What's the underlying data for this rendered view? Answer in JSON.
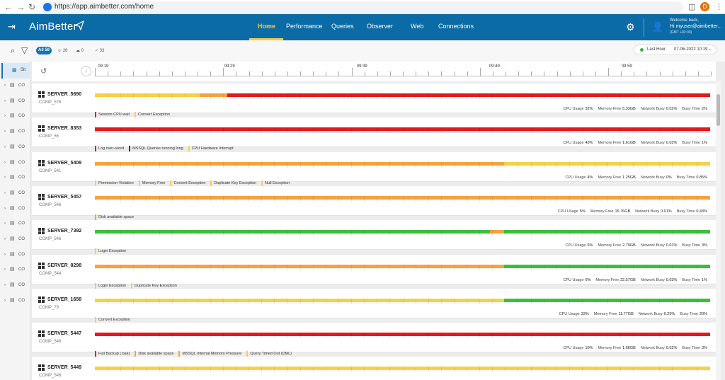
{
  "browser": {
    "url": "https://app.aimbetter.com/home",
    "profile_initial": "D"
  },
  "header": {
    "logo": "AimBetter",
    "tabs": [
      "Home",
      "Performance",
      "Queries",
      "Observer",
      "Web",
      "Connections"
    ],
    "active_tab": "Home",
    "welcome": "Welcome back,",
    "greeting": "Hi myuser@aimbetter...",
    "timezone": "(GMT +02:00)"
  },
  "filterbar": {
    "all_label": "All 59",
    "count_users": "26",
    "count_cloud": "0",
    "count_check": "33",
    "time_range": "Last Hour",
    "time_value": "07-06-2022 10:19"
  },
  "sidebar": {
    "header_label": "Sit",
    "items": [
      "CO",
      "CO",
      "CO",
      "CO",
      "CO",
      "CO",
      "CO",
      "CO",
      "CO",
      "CO",
      "CO",
      "CO",
      "CO",
      "CO",
      "CO"
    ]
  },
  "timeline": {
    "labels": [
      "09:19",
      "09:29",
      "09:39",
      "09:49",
      "09:59"
    ]
  },
  "colors": {
    "red": "#e11b1b",
    "yellow": "#f3d24a",
    "orange": "#f4a43c",
    "green": "#3dbe3d",
    "navy": "#1f3a5a",
    "blue": "#2a8ad5",
    "brand": "#0a6ba6"
  },
  "metric_labels": {
    "cpu": "CPU Usage",
    "mem": "Memory Free",
    "net": "Network Busy",
    "busy": "Busy Time"
  },
  "servers": [
    {
      "name": "SERVER_5690",
      "comp": "COMP_576",
      "segments": [
        {
          "from": 0,
          "to": 0.17,
          "color": "yellow"
        },
        {
          "from": 0.17,
          "to": 0.215,
          "color": "orange"
        },
        {
          "from": 0.215,
          "to": 1,
          "color": "red"
        }
      ],
      "alerts": [
        {
          "label": "Session CPU wait",
          "color": "red"
        },
        {
          "label": "Convert Exception",
          "color": "yellow"
        }
      ],
      "cpu": "32%",
      "mem": "5.33GB",
      "net": "0.02%",
      "busy": "2%"
    },
    {
      "name": "SERVER_8353",
      "comp": "COMP_66",
      "segments": [
        {
          "from": 0,
          "to": 1,
          "color": "red"
        }
      ],
      "blue_line": true,
      "alerts": [
        {
          "label": "Log over-sized",
          "color": "red"
        },
        {
          "label": "MSSQL Queries running long",
          "color": "navy"
        },
        {
          "label": "CPU Hardware Interrupt",
          "color": "yellow"
        }
      ],
      "cpu": "43%",
      "mem": "1.61GB",
      "net": "0.03%",
      "busy": "1%"
    },
    {
      "name": "SERVER_5409",
      "comp": "COMP_541",
      "segments": [
        {
          "from": 0,
          "to": 0.665,
          "color": "orange"
        },
        {
          "from": 0.665,
          "to": 1,
          "color": "yellow"
        }
      ],
      "alerts": [
        {
          "label": "Permission Violation",
          "color": "yellow"
        },
        {
          "label": "Memory Free",
          "color": "yellow"
        },
        {
          "label": "Convert Exception",
          "color": "yellow"
        },
        {
          "label": "Duplicate Key Exception",
          "color": "yellow"
        },
        {
          "label": "Null Exception",
          "color": "yellow"
        }
      ],
      "cpu": "4%",
      "mem": "1.25GB",
      "net": "0%",
      "busy": "0.85%"
    },
    {
      "name": "SERVER_5457",
      "comp": "COMP_546",
      "segments": [
        {
          "from": 0,
          "to": 1,
          "color": "orange"
        }
      ],
      "alerts": [
        {
          "label": "Disk available space",
          "color": "orange"
        }
      ],
      "cpu": "5%",
      "mem": "15.76GB",
      "net": "0.01%",
      "busy": "0.43%"
    },
    {
      "name": "SERVER_7392",
      "comp": "COMP_546",
      "segments": [
        {
          "from": 0,
          "to": 0.642,
          "color": "green"
        },
        {
          "from": 0.642,
          "to": 0.665,
          "color": "orange"
        },
        {
          "from": 0.665,
          "to": 1,
          "color": "green"
        }
      ],
      "alerts": [
        {
          "label": "Login Exception",
          "color": "yellow"
        }
      ],
      "cpu": "6%",
      "mem": "2.79GB",
      "net": "0.01%",
      "busy": "3%"
    },
    {
      "name": "SERVER_8298",
      "comp": "COMP_544",
      "segments": [
        {
          "from": 0,
          "to": 0.665,
          "color": "orange"
        },
        {
          "from": 0.665,
          "to": 1,
          "color": "green"
        }
      ],
      "alerts": [
        {
          "label": "Login Exception",
          "color": "yellow"
        },
        {
          "label": "Duplicate Key Exception",
          "color": "yellow"
        }
      ],
      "cpu": "6%",
      "mem": "22.57GB",
      "net": "0.03%",
      "busy": "1%"
    },
    {
      "name": "SERVER_1658",
      "comp": "COMP_79",
      "segments": [
        {
          "from": 0,
          "to": 0.665,
          "color": "yellow"
        },
        {
          "from": 0.665,
          "to": 1,
          "color": "green"
        }
      ],
      "alerts": [
        {
          "label": "Convert Exception",
          "color": "yellow"
        }
      ],
      "cpu": "33%",
      "mem": "11.77GB",
      "net": "0.25%",
      "busy": "20%"
    },
    {
      "name": "SERVER_5447",
      "comp": "COMP_546",
      "segments": [
        {
          "from": 0,
          "to": 1,
          "color": "red"
        }
      ],
      "alerts": [
        {
          "label": "Full Backup (.bak)",
          "color": "red"
        },
        {
          "label": "Disk available space",
          "color": "orange"
        },
        {
          "label": "MSSQL Internal Memory Pressure",
          "color": "orange"
        },
        {
          "label": "Query Timed Out (DML)",
          "color": "yellow"
        }
      ],
      "cpu": "10%",
      "mem": "1.66GB",
      "net": "0.02%",
      "busy": "3%"
    },
    {
      "name": "SERVER_5449",
      "comp": "COMP_546",
      "segments": [
        {
          "from": 0,
          "to": 1,
          "color": "yellow"
        }
      ],
      "alerts": [],
      "cpu": "",
      "mem": "",
      "net": "",
      "busy": ""
    }
  ]
}
